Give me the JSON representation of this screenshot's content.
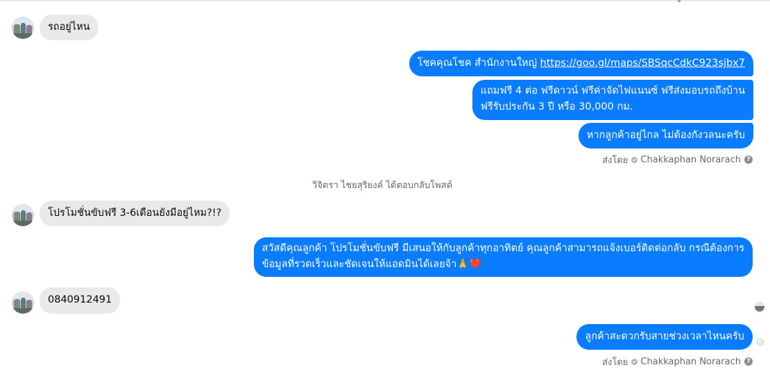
{
  "conversation": {
    "messages": [
      {
        "id": "m1",
        "direction": "incoming",
        "text": "รถอยู่ไหน"
      },
      {
        "id": "m2",
        "direction": "outgoing",
        "text_prefix": "โชคคุณโชค สำนักงานใหญ่ ",
        "link": "https://goo.gl/maps/SBSqcCdkC923sjbx7"
      },
      {
        "id": "m3",
        "direction": "outgoing",
        "lines": [
          "แถมฟรี 4 ต่อ ฟรีดาวน์ ฟรีค่าจัดไฟแนนซ์ ฟรีส่งมอบรถถึงบ้าน",
          "ฟรีรับประกัน 3 ปี หรือ 30,000 กม."
        ]
      },
      {
        "id": "m4",
        "direction": "outgoing",
        "text": "หากลูกค้าอยู่ไกล ไม่ต้องกังวลนะครับ"
      },
      {
        "id": "m5",
        "direction": "incoming",
        "text": "โปรโมชั่นขับฟรี 3-6เดือนยังมีอยู่ไหม?!?"
      },
      {
        "id": "m6",
        "direction": "outgoing",
        "lines": [
          "สวัสดีคุณลูกค้า โปรโมชั่นขับฟรี มีเสนอให้กับลูกค้าทุกอาทิตย์ คุณลูกค้าสามารถแจ้งเบอร์ติดต่อกลับ กรณีต้องการ",
          "ข้อมูลที่รวดเร็วและชัดเจนให้แอดมินได้เลยจ้า🙏❤️"
        ]
      },
      {
        "id": "m7",
        "direction": "incoming",
        "text": "0840912491"
      },
      {
        "id": "m8",
        "direction": "outgoing",
        "text": "ลูกค้าสะดวกรับสายช่วงเวลาไหนครับ"
      }
    ],
    "sent_by_1": {
      "prefix": "ส่งโดย",
      "name": "Chakkaphan Norarach",
      "help": "?"
    },
    "sent_by_2": {
      "prefix": "ส่งโดย",
      "name": "Chakkaphan Norarach",
      "help": "?"
    },
    "system_notice": "วิจิตรา ไชยสุริยงค์ ได้ตอบกลับโพสต์"
  },
  "colors": {
    "outgoing_bubble": "#0a7cff",
    "incoming_bubble": "#e9e9ea",
    "meta_text": "#65676b"
  },
  "icons": {
    "avatar": "contact-avatar-photo",
    "verified": "check-circle-icon",
    "help": "question-circle-icon",
    "seen": "seen-avatar-icon",
    "sent": "sent-check-icon"
  }
}
